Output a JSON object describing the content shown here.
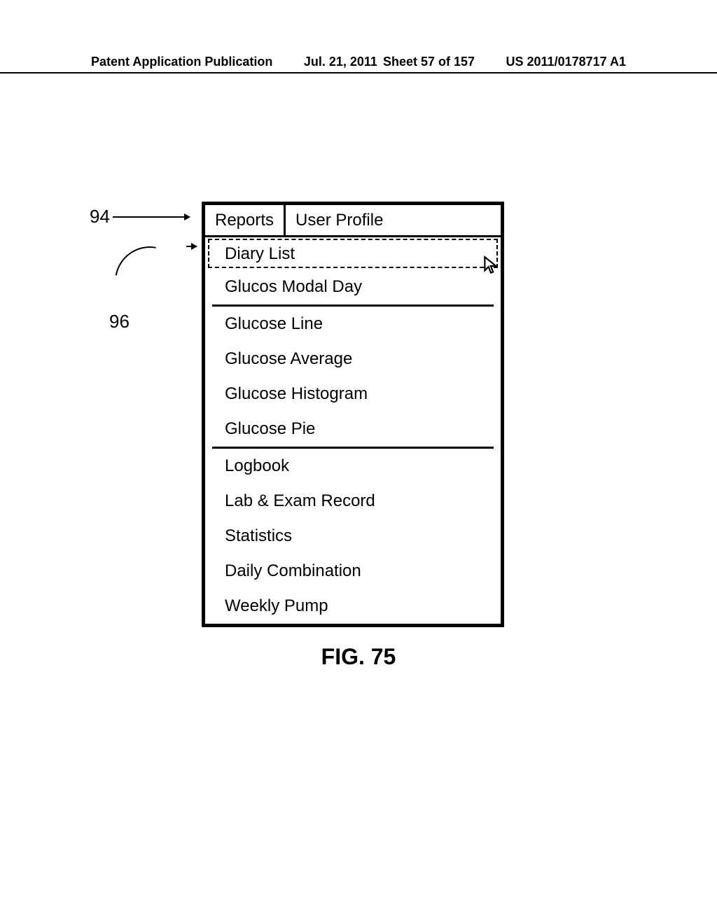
{
  "header": {
    "publication_type": "Patent Application Publication",
    "date": "Jul. 21, 2011",
    "sheet_label": "Sheet 57 of 157",
    "pub_number": "US 2011/0178717 A1"
  },
  "callouts": {
    "ref_94": "94",
    "ref_96": "96"
  },
  "tabs": {
    "reports": "Reports",
    "user_profile": "User Profile"
  },
  "menu": {
    "group1": [
      "Diary List",
      "Glucos Modal Day"
    ],
    "group2": [
      "Glucose Line",
      "Glucose Average",
      "Glucose Histogram",
      "Glucose Pie"
    ],
    "group3": [
      "Logbook",
      "Lab & Exam Record",
      "Statistics",
      "Daily Combination",
      "Weekly Pump"
    ]
  },
  "figure_caption": "FIG. 75"
}
